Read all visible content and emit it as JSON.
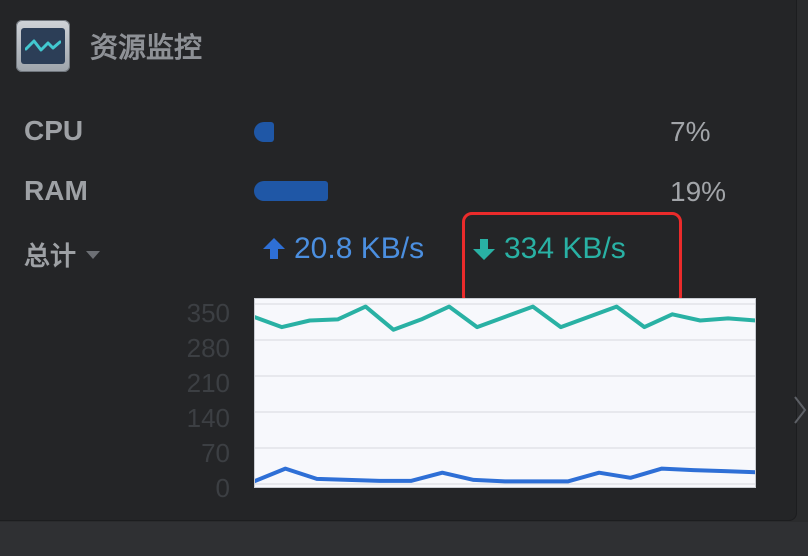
{
  "widget": {
    "title": "资源监控",
    "icon": "activity-monitor-icon"
  },
  "cpu": {
    "label": "CPU",
    "percent_text": "7%",
    "percent": 7
  },
  "ram": {
    "label": "RAM",
    "percent_text": "19%",
    "percent": 19
  },
  "network": {
    "selector_label": "总计",
    "upload": "20.8 KB/s",
    "download": "334 KB/s"
  },
  "colors": {
    "upload": "#2e6fd6",
    "download": "#29b1a4",
    "bar": "#1f57a6",
    "highlight": "#ea2b2b"
  },
  "chart_data": {
    "type": "line",
    "title": "",
    "xlabel": "",
    "ylabel": "",
    "ylim": [
      0,
      350
    ],
    "y_ticks": [
      "350",
      "280",
      "210",
      "140",
      "70",
      "0"
    ],
    "grid": true,
    "series": [
      {
        "color": "#29b1a4",
        "values": [
          325,
          305,
          318,
          320,
          345,
          300,
          320,
          345,
          305,
          325,
          345,
          305,
          325,
          345,
          305,
          330,
          318,
          322,
          318
        ]
      },
      {
        "color": "#2e6fd6",
        "values": [
          5,
          30,
          10,
          8,
          6,
          6,
          22,
          8,
          5,
          5,
          5,
          22,
          12,
          30,
          27,
          25,
          23
        ]
      }
    ]
  }
}
